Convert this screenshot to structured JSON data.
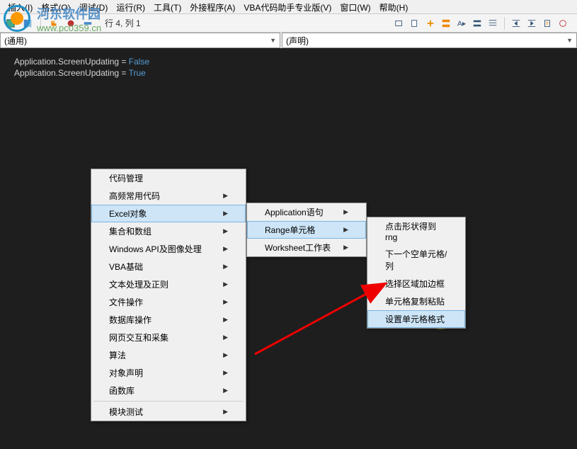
{
  "menubar": {
    "items": [
      {
        "label": "插入(I)",
        "key": "I"
      },
      {
        "label": "格式(O)",
        "key": "O"
      },
      {
        "label": "调试(D)",
        "key": "D"
      },
      {
        "label": "运行(R)",
        "key": "R"
      },
      {
        "label": "工具(T)",
        "key": "T"
      },
      {
        "label": "外接程序(A)",
        "key": "A"
      },
      {
        "label": "VBA代码助手专业版(V)",
        "key": "V"
      },
      {
        "label": "窗口(W)",
        "key": "W"
      },
      {
        "label": "帮助(H)",
        "key": "H"
      }
    ]
  },
  "toolbar": {
    "cursor_position": "行 4, 列 1"
  },
  "watermark": {
    "name": "河东软件园",
    "url": "www.pc0359.cn"
  },
  "dropdowns": {
    "left": "(通用)",
    "right": "(声明)"
  },
  "code": {
    "line1_left": "Application.ScreenUpdating = ",
    "line1_right": "False",
    "line2": "",
    "line3_left": "Application.ScreenUpdating = ",
    "line3_right": "True"
  },
  "menu1": {
    "items": [
      {
        "label": "代码管理",
        "sub": false
      },
      {
        "label": "高频常用代码",
        "sub": true
      },
      {
        "label": "Excel对象",
        "sub": true,
        "hl": true
      },
      {
        "label": "集合和数组",
        "sub": true
      },
      {
        "label": "Windows API及图像处理",
        "sub": true
      },
      {
        "label": "VBA基础",
        "sub": true
      },
      {
        "label": "文本处理及正则",
        "sub": true
      },
      {
        "label": "文件操作",
        "sub": true
      },
      {
        "label": "数据库操作",
        "sub": true
      },
      {
        "label": "网页交互和采集",
        "sub": true
      },
      {
        "label": "算法",
        "sub": true
      },
      {
        "label": "对象声明",
        "sub": true
      },
      {
        "label": "函数库",
        "sub": true
      }
    ],
    "sep_label": "模块测试"
  },
  "menu2": {
    "items": [
      {
        "label": "Application语句",
        "sub": true
      },
      {
        "label": "Range单元格",
        "sub": true,
        "hl": true
      },
      {
        "label": "Worksheet工作表",
        "sub": true
      }
    ]
  },
  "menu3": {
    "items": [
      {
        "label": "点击形状得到rng",
        "sub": false
      },
      {
        "label": "下一个空单元格/列",
        "sub": false
      },
      {
        "label": "选择区域加边框",
        "sub": false
      },
      {
        "label": "单元格复制粘贴",
        "sub": false
      },
      {
        "label": "设置单元格格式",
        "sub": false,
        "hl": true
      }
    ]
  }
}
